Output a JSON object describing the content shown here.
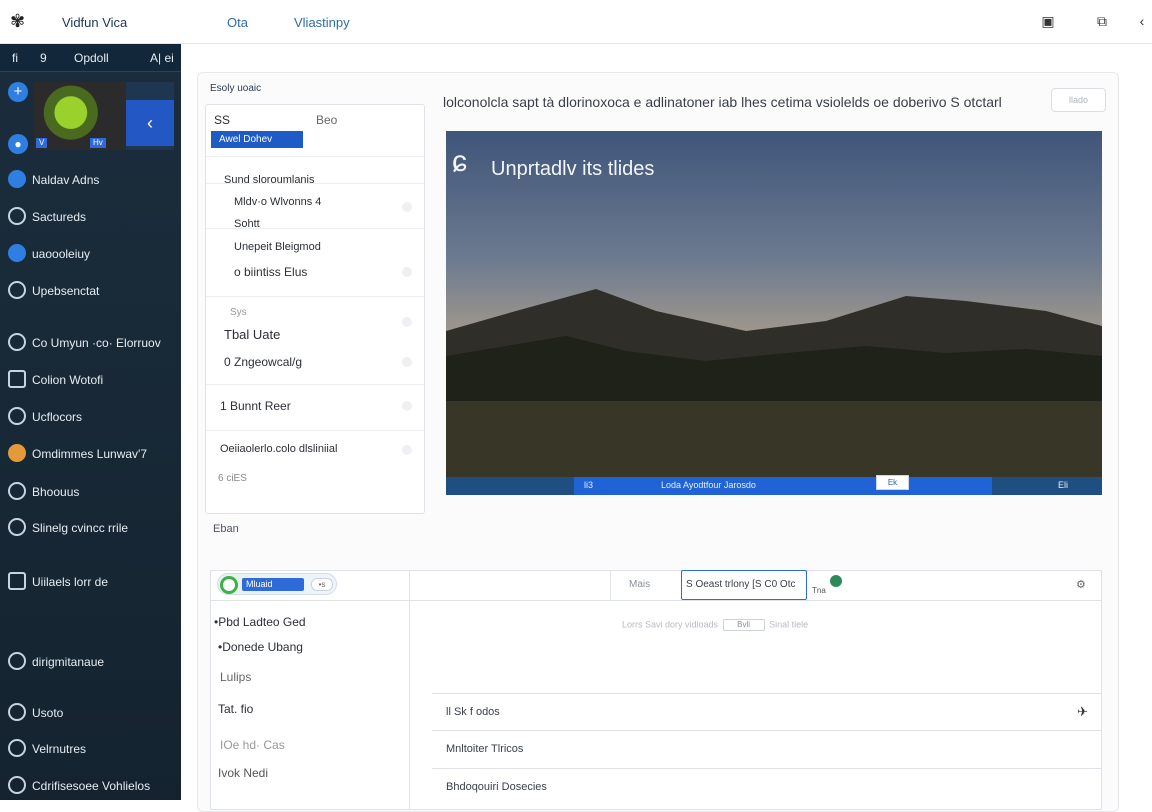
{
  "topbar": {
    "app_title": "Vidfun Vica",
    "nav": [
      "Ota",
      "Vliastinpy"
    ],
    "icons": [
      "window-icon",
      "collapse-icon",
      "back-icon"
    ]
  },
  "sidebar": {
    "header": [
      "fi",
      "9",
      "Opdoll",
      "A| ei"
    ],
    "card_tags": [
      "V",
      "Hv"
    ],
    "items": [
      {
        "label": "Naldav Adns",
        "icon": "globe-icon",
        "style": "fill"
      },
      {
        "label": "Sactureds",
        "icon": "circle-icon",
        "style": ""
      },
      {
        "label": "uaoooleiuy",
        "icon": "plus-icon",
        "style": "fill"
      },
      {
        "label": "Upebsenctat",
        "icon": "circle-icon",
        "style": ""
      },
      {
        "label": "Co Umyun ·co· Elorruov",
        "icon": "circle-icon",
        "style": ""
      },
      {
        "label": "Colion Wotofi",
        "icon": "person-icon",
        "style": "sq"
      },
      {
        "label": "Ucflocors",
        "icon": "bag-icon",
        "style": ""
      },
      {
        "label": "Omdimmes Lunwav'7",
        "icon": "bolt-icon",
        "style": "orange"
      },
      {
        "label": "Bhoouus",
        "icon": "swirl-icon",
        "style": ""
      },
      {
        "label": "Slinelg cvincc rrile",
        "icon": "heart-icon",
        "style": ""
      },
      {
        "label": "Uiilaels lorr de",
        "icon": "bin-icon",
        "style": "sq"
      },
      {
        "label": "dirigmitanaue",
        "icon": "chevron-icon",
        "style": ""
      },
      {
        "label": "Usoto",
        "icon": "circle-icon",
        "style": ""
      },
      {
        "label": "Velrnutres",
        "icon": "bell-icon",
        "style": ""
      },
      {
        "label": "Cdrifisesoee Vohlielos",
        "icon": "book-icon",
        "style": ""
      }
    ]
  },
  "panel": {
    "title": "Esoly uoaic",
    "selected_pill": "Awel Dohev",
    "list": [
      {
        "a": "SS",
        "b": "Beo",
        "c": ""
      },
      {
        "a": "Sund sloroumlanis",
        "b": "Mldv·o Wlvonns 4",
        "c": "Sohtt"
      },
      {
        "a": "Unepeit Bleigmod",
        "b": "o biintiss Elus",
        "c": ""
      },
      {
        "a": "Sys",
        "b": "Tbal Uate",
        "c": "0 Zngeowcal/g"
      },
      {
        "a": "1 Bunnt Reer",
        "b": "",
        "c": ""
      },
      {
        "a": "Oeiiaolerlo.colo dlsliniial",
        "b": "6 ciES",
        "c": ""
      }
    ]
  },
  "caption": {
    "text": "lolconolcla sapt tà dlorinoxoca e adlinatoner iab lhes cetima vsiolelds oe doberivo S otctarl",
    "button": "llado"
  },
  "hero": {
    "title": "Unprtadlv its tlides",
    "bar_items": [
      "li3",
      "Loda  Ayodtfour  Jarosdo"
    ],
    "bar_box": "Ek",
    "bar_right": "Eli"
  },
  "eban": "Eban",
  "grid": {
    "toggle_label": "Mluaid",
    "toggle_side": "•s",
    "hint": "Mais",
    "input_value": "S Oeast trlony [S C0 Otc",
    "g_label": "Tna",
    "ghost": [
      "Lorrs Savi dory vidioads",
      "Bvli",
      "Sinal tiele"
    ],
    "left": [
      "•Pbd Ladteo Ged",
      "•Donede Ubang",
      "Lulips",
      "Tat. fio",
      "IOe  hd·  Cas",
      "Ivok Nedi"
    ],
    "mid": [
      {
        "text": "ll  Sk f odos",
        "end": "✈"
      },
      {
        "text": "Mnltoiter Tlricos",
        "end": ""
      },
      {
        "text": "Bhdoqouiri Dosecies",
        "end": ""
      }
    ]
  }
}
